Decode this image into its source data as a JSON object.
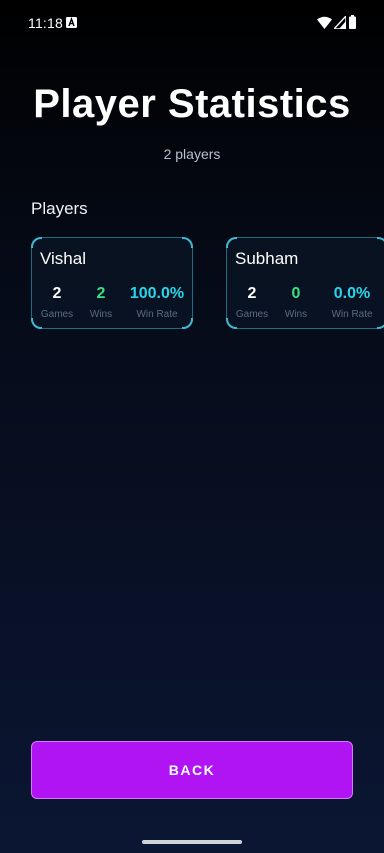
{
  "status_bar": {
    "time": "11:18",
    "icons": [
      "notification-a-icon",
      "wifi-icon",
      "signal-icon",
      "battery-icon"
    ]
  },
  "header": {
    "title": "Player Statistics",
    "subtitle": "2 players"
  },
  "players_section": {
    "heading": "Players",
    "players": [
      {
        "name": "Vishal",
        "games": "2",
        "games_label": "Games",
        "wins": "2",
        "wins_label": "Wins",
        "win_rate": "100.0%",
        "win_rate_label": "Win Rate"
      },
      {
        "name": "Subham",
        "games": "2",
        "games_label": "Games",
        "wins": "0",
        "wins_label": "Wins",
        "win_rate": "0.0%",
        "win_rate_label": "Win Rate"
      }
    ]
  },
  "footer": {
    "back_label": "BACK"
  },
  "colors": {
    "accent_button": "#b014f2",
    "wins": "#35e27d",
    "win_rate": "#27d6ea",
    "card_border": "#1d6c80"
  }
}
